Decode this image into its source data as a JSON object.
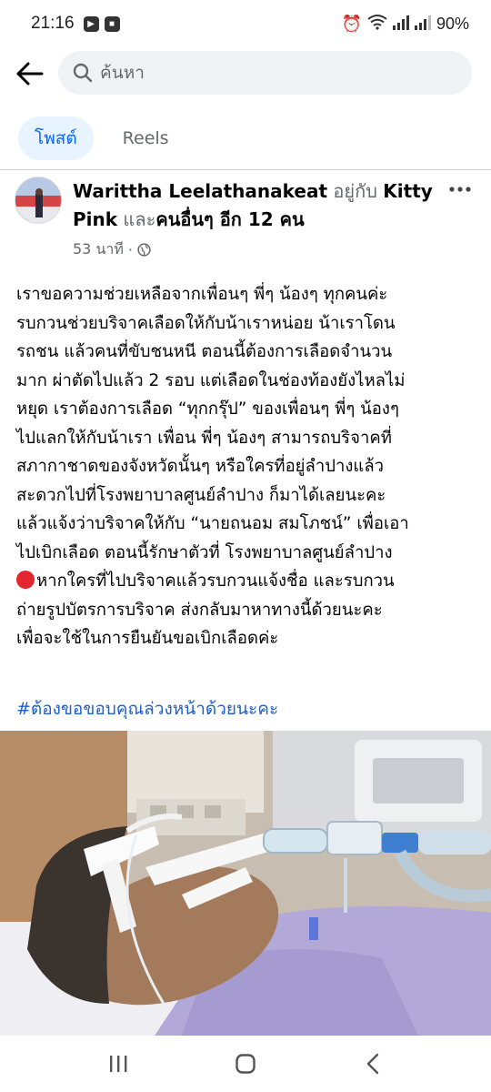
{
  "status_bar": {
    "time": "21:16",
    "battery": "90%"
  },
  "search": {
    "placeholder": "ค้นหา"
  },
  "tabs": [
    {
      "label": "โพสต์",
      "active": true
    },
    {
      "label": "Reels",
      "active": false
    }
  ],
  "post": {
    "author": "Warittha Leelathanakeat",
    "with_word": "อยู่กับ",
    "tagged_name": "Kitty Pink",
    "and_word": "และ",
    "others": "คนอื่นๆ อีก 12 คน",
    "timestamp": "53 นาที",
    "visibility_icon": "globe-icon",
    "body_lines": [
      "เราขอความช่วยเหลือจากเพื่อนๆ พี่ๆ น้องๆ ทุกคนค่ะ",
      "รบกวนช่วยบริจาคเลือดให้กับน้าเราหน่อย น้าเราโดน",
      "รถชน แล้วคนที่ขับชนหนี ตอนนี้ต้องการเลือดจำนวน",
      "มาก ผ่าตัดไปแล้ว 2 รอบ แต่เลือดในช่องท้องยังไหลไม่",
      "หยุด เราต้องการเลือด “ทุกกรุ๊ป” ของเพื่อนๆ พี่ๆ น้องๆ",
      "ไปแลกให้กับน้าเรา เพื่อน พี่ๆ น้องๆ สามารถบริจาคที่",
      "สภากาชาดของจังหวัดนั้นๆ หรือใครที่อยู่ลำปางแล้ว",
      "สะดวกไปที่โรงพยาบาลศูนย์ลำปาง ก็มาได้เลยนะคะ",
      "แล้วแจ้งว่าบริจาคให้กับ “นายถนอม สมโภชน์” เพื่อเอา",
      "ไปเบิกเลือด ตอนนี้รักษาตัวที่ โรงพยาบาลศูนย์ลำปาง",
      "หากใครที่ไปบริจาคแล้วรบกวนแจ้งชื่อ และรบกวน",
      "ถ่ายรูปบัตรการบริจาค ส่งกลับมาหาทางนี้ด้วยนะคะ",
      "เพื่อจะใช้ในการยืนยันขอเบิกเลือดค่ะ"
    ],
    "hashtag": "#ต้องขอขอบคุณล่วงหน้าด้วยนะคะ"
  },
  "colors": {
    "accent_blue": "#0866ff",
    "active_tab_bg": "#e7f3ff",
    "hashtag_blue": "#1d5fcf",
    "red_dot": "#e3262f"
  }
}
